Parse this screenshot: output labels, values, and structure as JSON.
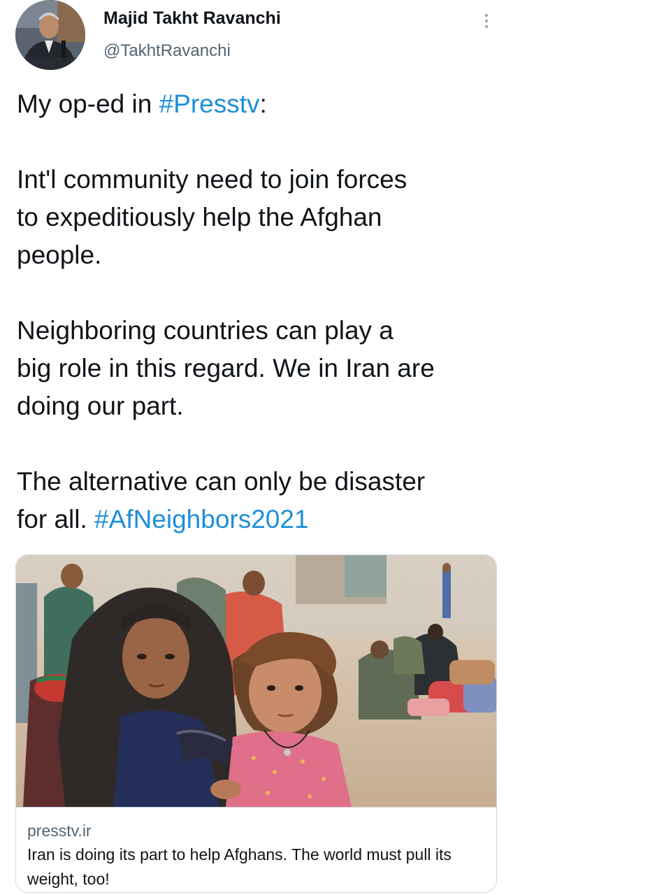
{
  "author": {
    "name": "Majid Takht Ravanchi",
    "handle": "@TakhtRavanchi"
  },
  "tweet": {
    "line1_prefix": "My op-ed in ",
    "line1_hashtag": "#Presstv",
    "line1_suffix": ":",
    "para2_l1": "Int'l community need to join forces",
    "para2_l2": "to expeditiously help the Afghan",
    "para2_l3": "people.",
    "para3_l1": "Neighboring countries can play a",
    "para3_l2": "big role in this regard. We in Iran are",
    "para3_l3": "doing our part.",
    "para4_l1": "The alternative can only be disaster",
    "para4_l2_prefix": "for all. ",
    "para4_hashtag": "#AfNeighbors2021"
  },
  "card": {
    "domain": "presstv.ir",
    "title": "Iran is doing its part to help Afghans. The world must pull its weight, too!"
  },
  "icons": {
    "more": "more-vertical-icon"
  },
  "colors": {
    "hashtag": "#1d8fd8",
    "text": "#0f1419",
    "secondary": "#536471",
    "border": "#cfd9de"
  }
}
